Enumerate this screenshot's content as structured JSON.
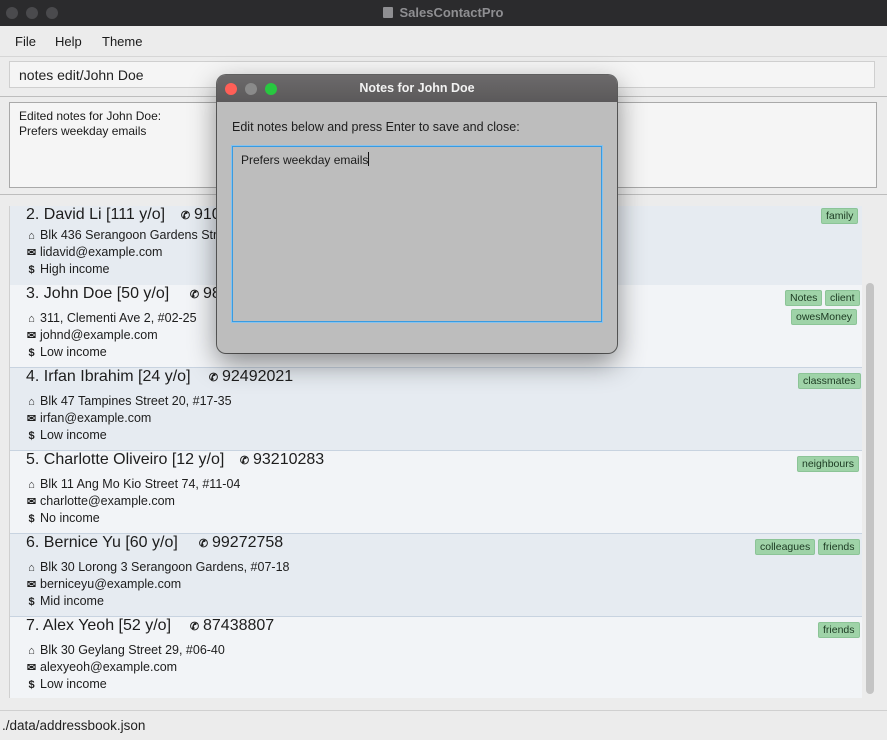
{
  "window": {
    "title": "SalesContactPro"
  },
  "menu": {
    "file": "File",
    "help": "Help",
    "theme": "Theme"
  },
  "command_input": {
    "value": "notes edit/John Doe"
  },
  "result_display": {
    "text": "Edited notes for John Doe:\nPrefers weekday emails"
  },
  "persons": [
    {
      "name": "2. David Li [111 y/o]",
      "phone": "910",
      "address": "Blk 436 Serangoon Gardens Stre",
      "email": "lidavid@example.com",
      "income": "High income",
      "tags": [
        "family"
      ]
    },
    {
      "name": "3. John Doe [50 y/o]",
      "phone": "98",
      "address": "311, Clementi Ave 2, #02-25",
      "email": "johnd@example.com",
      "income": "Low income",
      "tags": [
        "Notes",
        "client",
        "owesMoney"
      ]
    },
    {
      "name": "4. Irfan Ibrahim [24 y/o]",
      "phone": "92492021",
      "address": "Blk 47 Tampines Street 20, #17-35",
      "email": "irfan@example.com",
      "income": "Low income",
      "tags": [
        "classmates"
      ]
    },
    {
      "name": "5. Charlotte Oliveiro [12 y/o]",
      "phone": "93210283",
      "address": "Blk 11 Ang Mo Kio Street 74, #11-04",
      "email": "charlotte@example.com",
      "income": "No income",
      "tags": [
        "neighbours"
      ]
    },
    {
      "name": "6. Bernice Yu [60 y/o]",
      "phone": "99272758",
      "address": "Blk 30 Lorong 3 Serangoon Gardens, #07-18",
      "email": "berniceyu@example.com",
      "income": "Mid income",
      "tags": [
        "colleagues",
        "friends"
      ]
    },
    {
      "name": "7. Alex Yeoh [52 y/o]",
      "phone": "87438807",
      "address": "Blk 30 Geylang Street 29, #06-40",
      "email": "alexyeoh@example.com",
      "income": "Low income",
      "tags": [
        "friends"
      ]
    }
  ],
  "status_bar": {
    "path": "./data/addressbook.json"
  },
  "dialog": {
    "title": "Notes for John Doe",
    "prompt": "Edit notes below and press Enter to save and close:",
    "editor_value": "Prefers weekday emails"
  },
  "icons": {
    "address": "home-icon",
    "email": "mail-icon",
    "income": "dollar-icon",
    "phone": "phone-icon"
  },
  "colors": {
    "tag_bg": "#9fd3a8",
    "focus_border": "#3a9be0",
    "close": "#ff5f57",
    "minimize": "#8a8a8a",
    "zoom": "#28c840"
  }
}
